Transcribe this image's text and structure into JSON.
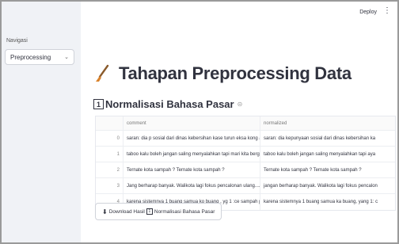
{
  "header": {
    "deploy_label": "Deploy",
    "menu_icon": "⋮"
  },
  "sidebar": {
    "label": "Navigasi",
    "select_value": "Preprocessing",
    "chevron": "⌄"
  },
  "page": {
    "title": "Tahapan Preprocessing Data",
    "title_icon": "broom-icon"
  },
  "section": {
    "number": "1",
    "title": "Normalisasi Bahasa Pasar",
    "anchor": "⊝"
  },
  "table": {
    "columns": [
      "comment",
      "normalized"
    ],
    "rows": [
      {
        "index": "0",
        "comment": "saran: dia p sosial dari dinas kebersihan kase turun eksa kong angko kase bersih di b",
        "normalized": "saran: dia kepunyaan sosial dari dinas kebersihan ka"
      },
      {
        "index": "1",
        "comment": "taboo kalu boleh jangan saling menyalahkan tapi mari kita bergandeng tangan untuk",
        "normalized": "taboo kalu boleh jangan saling menyalahkan tapi aya"
      },
      {
        "index": "2",
        "comment": "Ternate kota sampah ? Ternate kota sampah ?",
        "normalized": "Ternate kota sampah ? Ternate kota sampah ?"
      },
      {
        "index": "3",
        "comment": "Jang berharap banyak. Walikota lagi fokus pencalonan ulang....??",
        "normalized": "jangan berharap banyak. Walikota lagi fokus pencalon"
      },
      {
        "index": "4",
        "comment": "karena sistemnya 1 buang samua ko buang , yg 1 :ce sampah p wilkin ni sjkang buang",
        "normalized": "karena sistemnya 1 buang samua ka buang, yang 1: c"
      }
    ]
  },
  "download": {
    "icon": "⬇",
    "label_prefix": "Download Hasil",
    "label_number": "1",
    "label_suffix": "Normalisasi Bahasa Pasar"
  }
}
